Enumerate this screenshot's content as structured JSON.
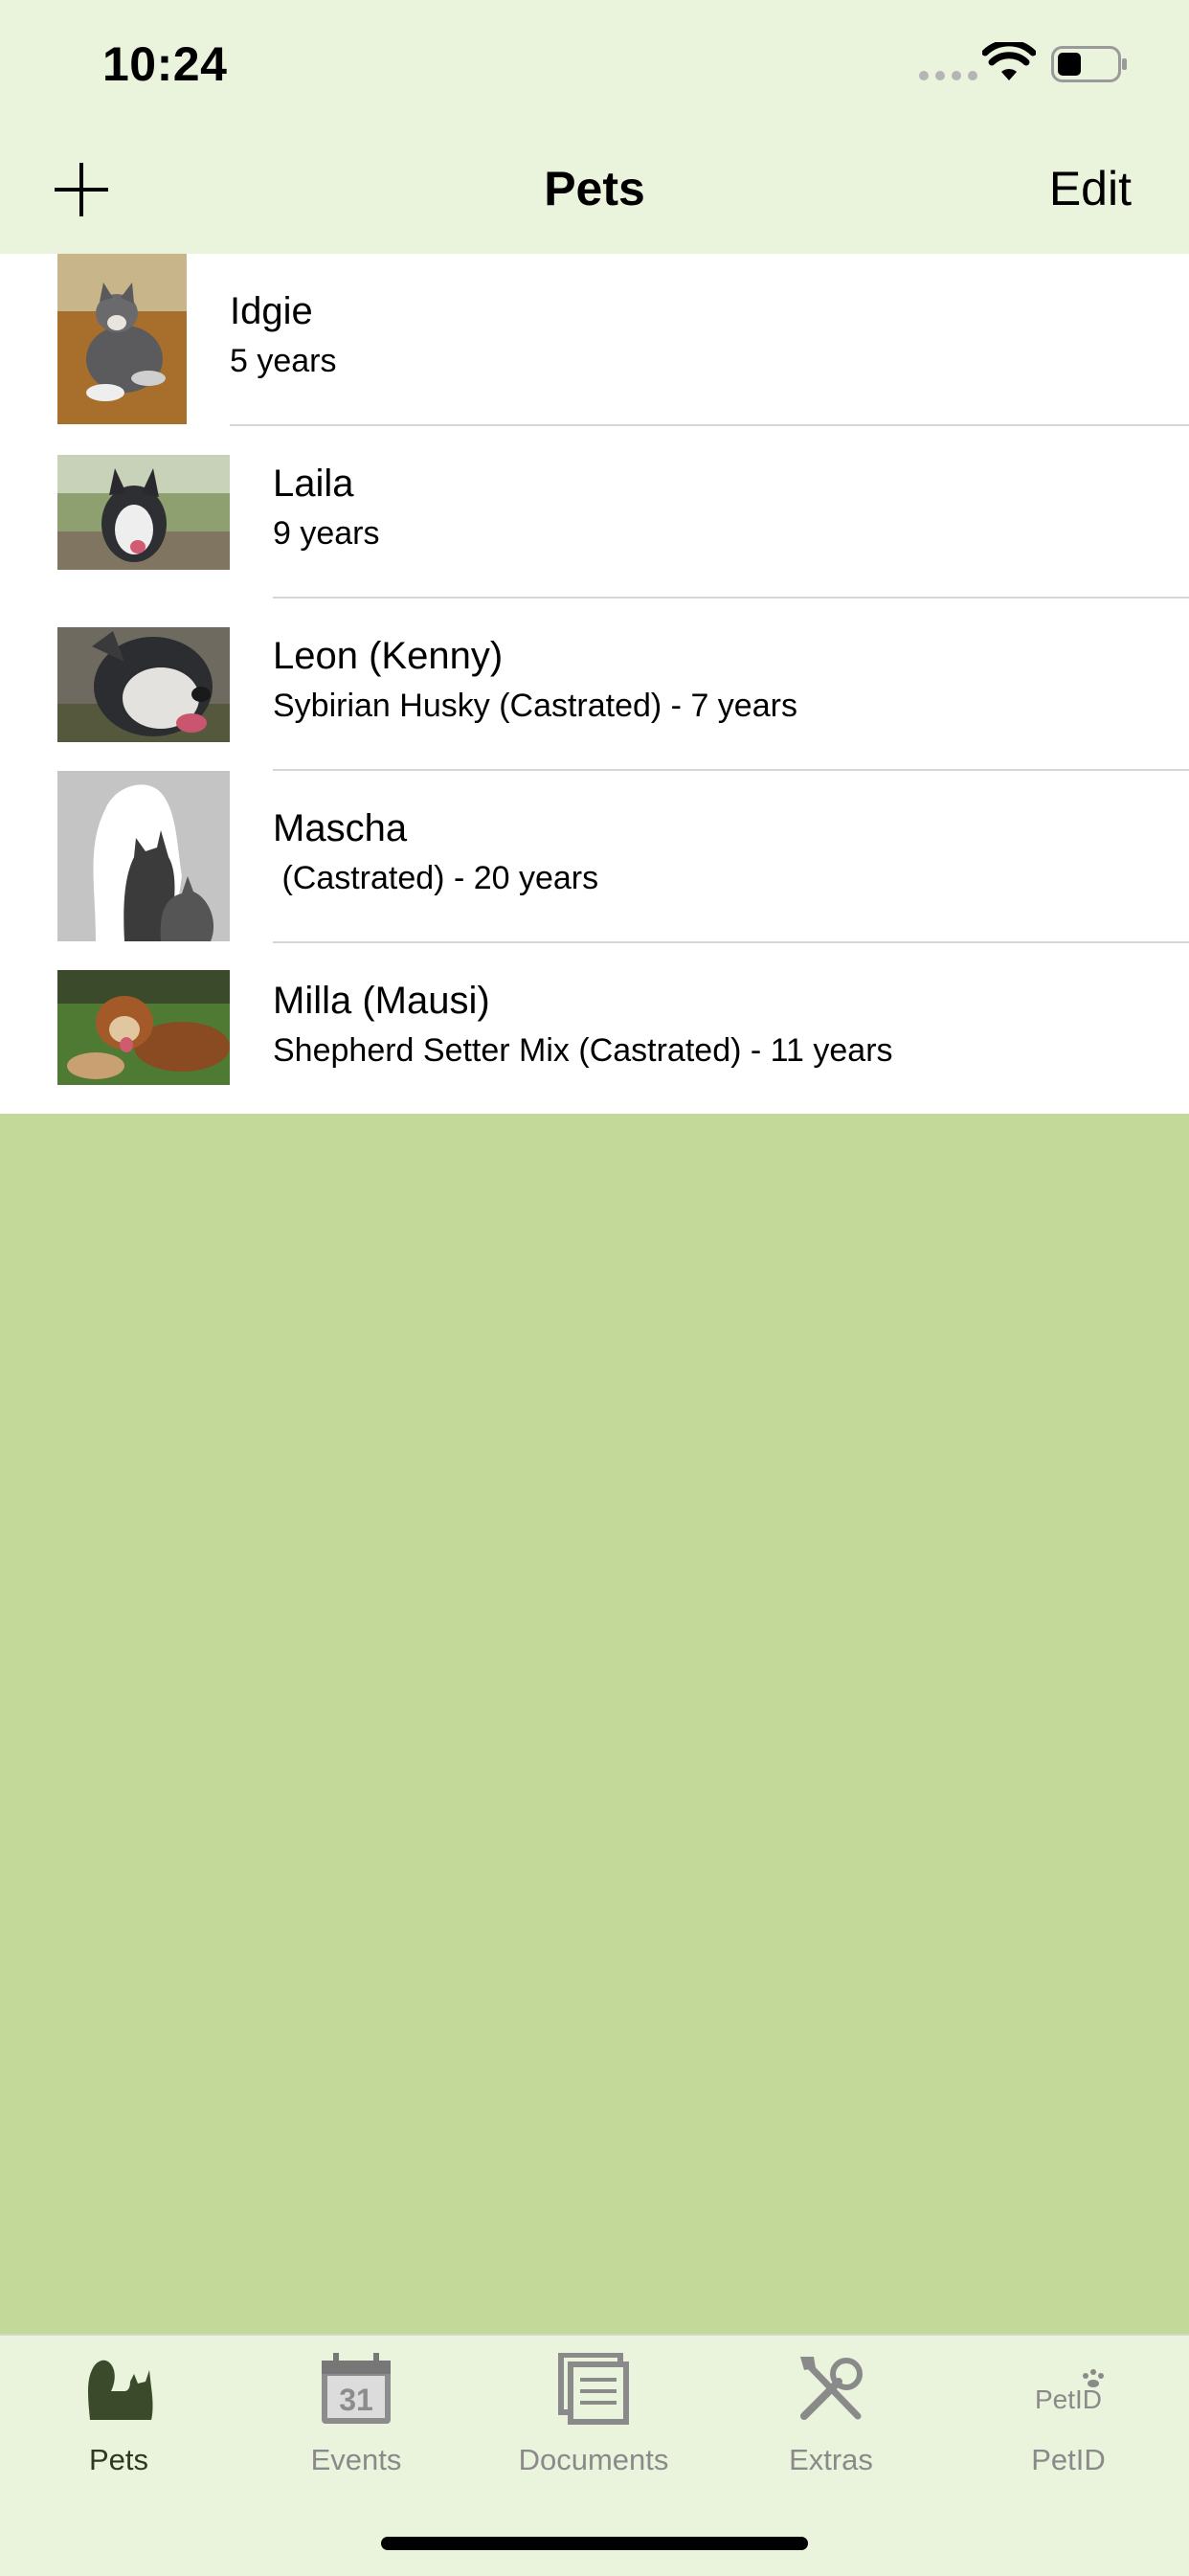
{
  "status_bar": {
    "time": "10:24"
  },
  "nav": {
    "title": "Pets",
    "edit_label": "Edit"
  },
  "pets": [
    {
      "name": "Idgie",
      "detail": "5 years"
    },
    {
      "name": "Laila",
      "detail": "9 years"
    },
    {
      "name": "Leon (Kenny)",
      "detail": "Sybirian Husky (Castrated) - 7 years"
    },
    {
      "name": "Mascha",
      "detail": " (Castrated) - 20 years"
    },
    {
      "name": "Milla (Mausi)",
      "detail": "Shepherd Setter Mix (Castrated) - 11 years"
    }
  ],
  "tabs": [
    {
      "label": "Pets",
      "icon": "pets-icon",
      "active": true
    },
    {
      "label": "Events",
      "icon": "calendar-icon",
      "calendar_day": "31",
      "active": false
    },
    {
      "label": "Documents",
      "icon": "documents-icon",
      "active": false
    },
    {
      "label": "Extras",
      "icon": "tools-icon",
      "active": false
    },
    {
      "label": "PetID",
      "icon": "petid-icon",
      "icon_text": "PetID",
      "active": false
    }
  ],
  "colors": {
    "background": "#c3d99a",
    "bar": "#eaf3dc",
    "active_tab": "#2e3a1f",
    "inactive_tab": "#8a8a8a"
  }
}
